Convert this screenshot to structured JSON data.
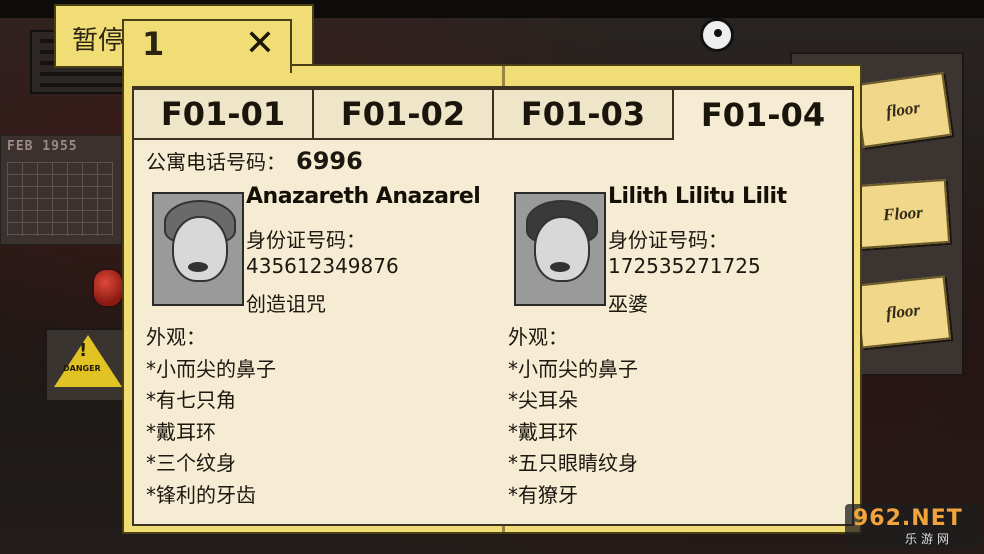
{
  "pause_tab": {
    "label": "暂停"
  },
  "folder": {
    "number": "1",
    "close_icon": "close-x-icon"
  },
  "background": {
    "calendar_header": "FEB 1955",
    "danger_label": "DANGER",
    "floor_labels": [
      "floor",
      "Floor",
      "floor"
    ]
  },
  "tabs": [
    {
      "label": "F01-01",
      "active": false
    },
    {
      "label": "F01-02",
      "active": false
    },
    {
      "label": "F01-03",
      "active": false
    },
    {
      "label": "F01-04",
      "active": true
    }
  ],
  "apartment": {
    "phone_label": "公寓电话号码：",
    "phone_value": "6996"
  },
  "residents": [
    {
      "name": "Anazareth Anazarel",
      "id_label": "身份证号码：",
      "id_number": "435612349876",
      "occupation": "创造诅咒",
      "appearance_label": "外观：",
      "traits": [
        "*小而尖的鼻子",
        "*有七只角",
        "*戴耳环",
        "*三个纹身",
        "*锋利的牙齿"
      ]
    },
    {
      "name": "Lilith Lilitu Lilit",
      "id_label": "身份证号码：",
      "id_number": "172535271725",
      "occupation": "巫婆",
      "appearance_label": "外观：",
      "traits": [
        "*小而尖的鼻子",
        "*尖耳朵",
        "*戴耳环",
        "*五只眼睛纹身",
        "*有獠牙"
      ]
    }
  ],
  "watermark": {
    "main": "962.NET",
    "sub": "乐游网"
  },
  "colors": {
    "folder": "#f1dd76",
    "paper": "#f5ecd3",
    "ink": "#1c1810"
  }
}
